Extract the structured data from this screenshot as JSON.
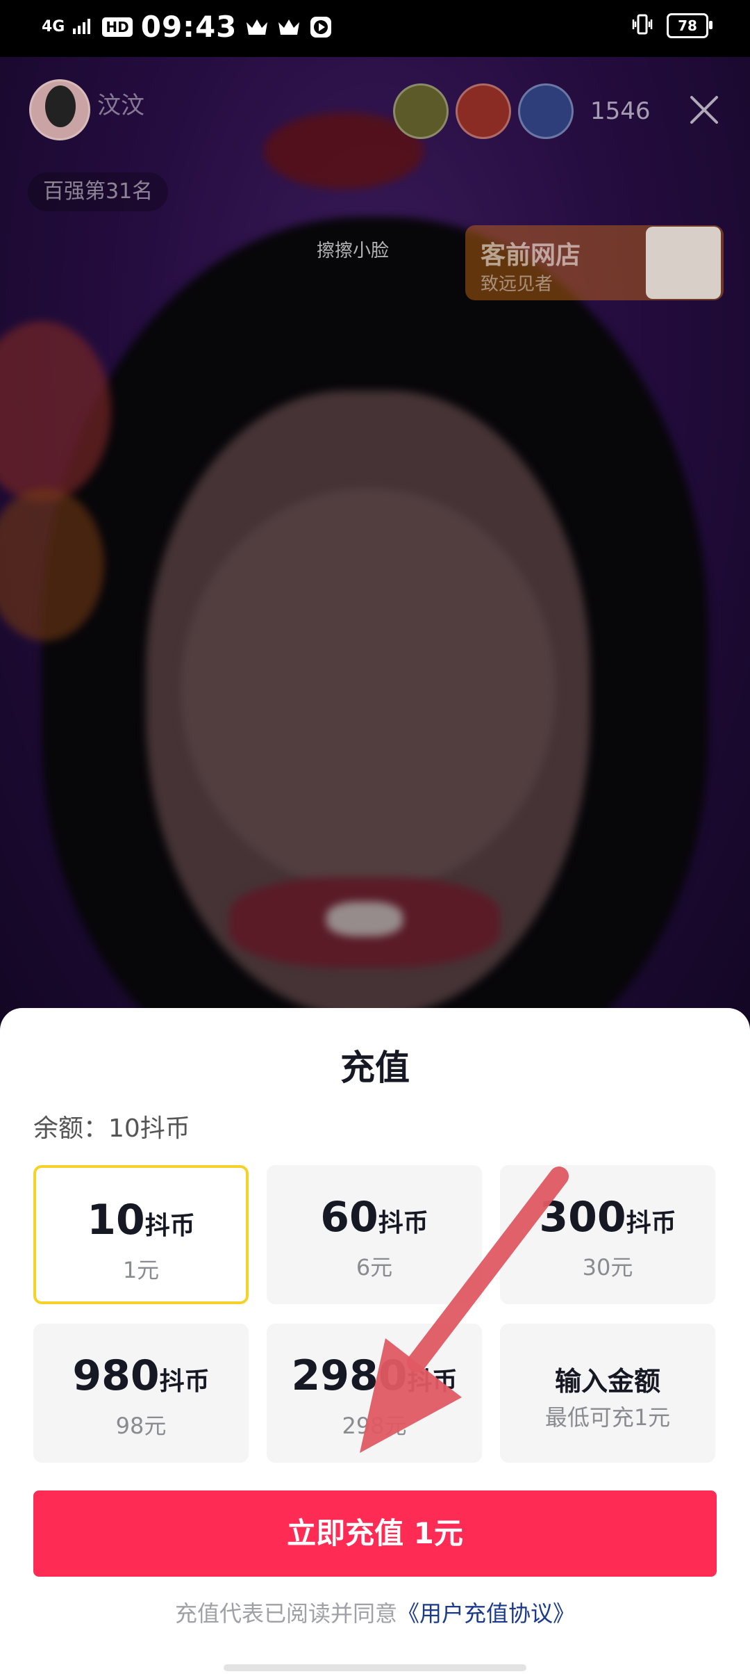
{
  "status_bar": {
    "network": "4G",
    "hd": "HD",
    "time": "09:43",
    "battery": "78"
  },
  "live": {
    "host_name": "汶汶",
    "viewer_count": "1546",
    "rank_label": "百强第31名",
    "promo_tag": "擦擦小脸",
    "shop_title": "客前网店",
    "shop_subtitle": "致远见者"
  },
  "sheet": {
    "title": "充值",
    "balance": "余额：10抖币",
    "options": [
      {
        "amount": "10",
        "unit": "抖币",
        "price": "1元",
        "selected": true
      },
      {
        "amount": "60",
        "unit": "抖币",
        "price": "6元",
        "selected": false
      },
      {
        "amount": "300",
        "unit": "抖币",
        "price": "30元",
        "selected": false
      },
      {
        "amount": "980",
        "unit": "抖币",
        "price": "98元",
        "selected": false
      },
      {
        "amount": "2980",
        "unit": "抖币",
        "price": "298元",
        "selected": false
      }
    ],
    "custom": {
      "title": "输入金额",
      "subtitle": "最低可充1元"
    },
    "recharge_button": "立即充值 1元",
    "agreement_text": "充值代表已阅读并同意",
    "agreement_link": "《用户充值协议》"
  },
  "colors": {
    "accent": "#fe2c55",
    "selected_border": "#f5d22a",
    "annotation_arrow": "#e05a63"
  }
}
